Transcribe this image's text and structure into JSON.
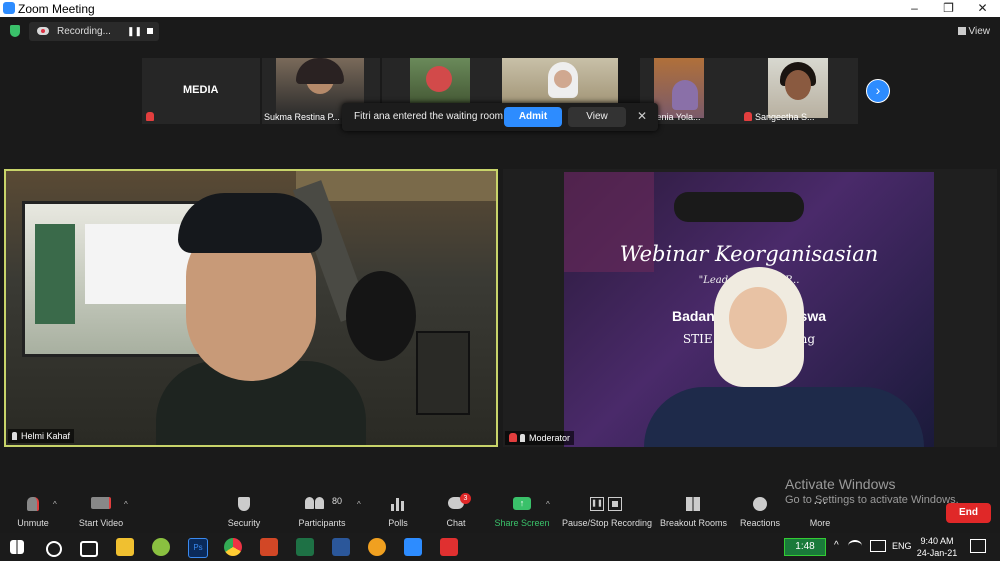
{
  "window": {
    "title": "Zoom Meeting",
    "controls": [
      "–",
      "❐",
      "✕"
    ]
  },
  "recording": {
    "label": "Recording...",
    "pause": "❚❚"
  },
  "view_button": "View",
  "gallery": {
    "tiles": [
      {
        "name": "MEDIA",
        "muted": true
      },
      {
        "name": "Sukma Restina P...",
        "muted": false
      },
      {
        "name": "",
        "muted": false
      },
      {
        "name": "",
        "muted": false
      },
      {
        "name": "...elenia Yola...",
        "muted": false
      },
      {
        "name": "Sangeetha S...",
        "muted": true
      }
    ],
    "next": "›"
  },
  "waiting_room": {
    "message": "Fitri ana entered the waiting room",
    "admit": "Admit",
    "view": "View",
    "close": "✕"
  },
  "main_videos": [
    {
      "name": "Helmi Kahaf",
      "active_speaker": true
    },
    {
      "name": "Moderator",
      "muted": true
    }
  ],
  "slide": {
    "title": "Webinar Keorganisasian",
    "subtitle": "\"Leadership and P...",
    "line1": "Badan Eksekut... siswa",
    "line2": "STIE PGRI Dew... ang"
  },
  "toolbar": {
    "unmute": "Unmute",
    "start_video": "Start Video",
    "security": "Security",
    "participants": "Participants",
    "participants_count": "80",
    "polls": "Polls",
    "chat": "Chat",
    "chat_badge": "3",
    "share_screen": "Share Screen",
    "pause_stop": "Pause/Stop Recording",
    "breakout": "Breakout Rooms",
    "reactions": "Reactions",
    "more": "More",
    "end": "End"
  },
  "activation": {
    "line1": "Activate Windows",
    "line2": "Go to Settings to activate Windows."
  },
  "taskbar": {
    "battery": "1:48",
    "lang": "ENG",
    "time": "9:40 AM",
    "date": "24-Jan-21"
  },
  "colors": {
    "accent": "#2d8cff",
    "end": "#e02828",
    "active_speaker_border": "#c8d46a",
    "share_green": "#3ac16a"
  }
}
